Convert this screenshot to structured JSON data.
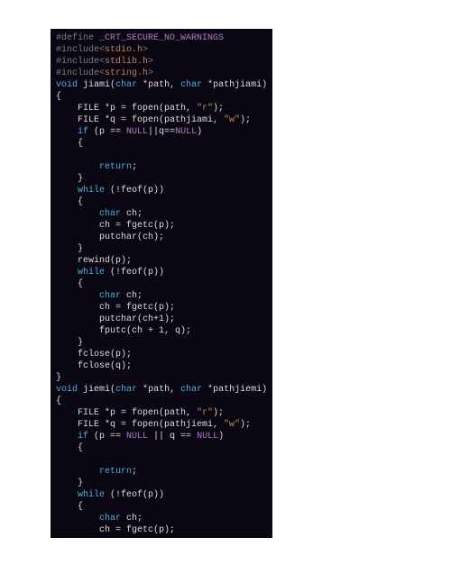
{
  "code": {
    "define": {
      "directive": "#define",
      "macro": "_CRT_SECURE_NO_WARNINGS"
    },
    "includes": [
      {
        "directive": "#include<",
        "file": "stdio.h",
        "end": ">"
      },
      {
        "directive": "#include<",
        "file": "stdlib.h",
        "end": ">"
      },
      {
        "directive": "#include<",
        "file": "string.h",
        "end": ">"
      }
    ],
    "jiami": {
      "ret": "void",
      "name": "jiami",
      "sig_open": "(",
      "p1t": "char",
      "p1n": " *path, ",
      "p2t": "char",
      "p2n": " *pathjiami)",
      "body": {
        "lbrace": "{",
        "l1a": "    FILE *p = fopen(path, ",
        "l1s": "\"r\"",
        "l1b": ");",
        "l2a": "    FILE *q = fopen(pathjiami, ",
        "l2s": "\"w\"",
        "l2b": ");",
        "ifkw": "    if",
        "ifcond_a": " (p == ",
        "null1": "NULL",
        "ifcond_b": "||q==",
        "null2": "NULL",
        "ifcond_c": ")",
        "if_l": "    {",
        "blank": "",
        "ret1": "        return",
        "ret1s": ";",
        "if_r": "    }",
        "while1": "    while",
        "wh1c": " (!feof(p))",
        "wh1l": "    {",
        "ch1t": "        char",
        "ch1n": " ch;",
        "l_fg1": "        ch = fgetc(p);",
        "l_pc1": "        putchar(ch);",
        "wh1r": "    }",
        "l_rw": "    rewind(p);",
        "while2": "    while",
        "wh2c": " (!feof(p))",
        "wh2l": "    {",
        "ch2t": "        char",
        "ch2n": " ch;",
        "l_fg2": "        ch = fgetc(p);",
        "l_pc2": "        putchar(ch+1);",
        "l_fp": "        fputc(ch + 1, q);",
        "wh2r": "    }",
        "l_fc1": "    fclose(p);",
        "l_fc2": "    fclose(q);",
        "rbrace": "}"
      }
    },
    "jiemi": {
      "ret": "void",
      "name": "jiemi",
      "sig_open": "(",
      "p1t": "char",
      "p1n": " *path, ",
      "p2t": "char",
      "p2n": " *pathjiemi)",
      "body": {
        "lbrace": "{",
        "l1a": "    FILE *p = fopen(path, ",
        "l1s": "\"r\"",
        "l1b": ");",
        "l2a": "    FILE *q = fopen(pathjiemi, ",
        "l2s": "\"w\"",
        "l2b": ");",
        "ifkw": "    if",
        "ifcond_a": " (p == ",
        "null1": "NULL",
        "ifcond_b": " || q == ",
        "null2": "NULL",
        "ifcond_c": ")",
        "if_l": "    {",
        "blank": "",
        "ret1": "        return",
        "ret1s": ";",
        "if_r": "    }",
        "while1": "    while",
        "wh1c": " (!feof(p))",
        "wh1l": "    {",
        "ch1t": "        char",
        "ch1n": " ch;",
        "l_fg1": "        ch = fgetc(p);"
      }
    }
  }
}
